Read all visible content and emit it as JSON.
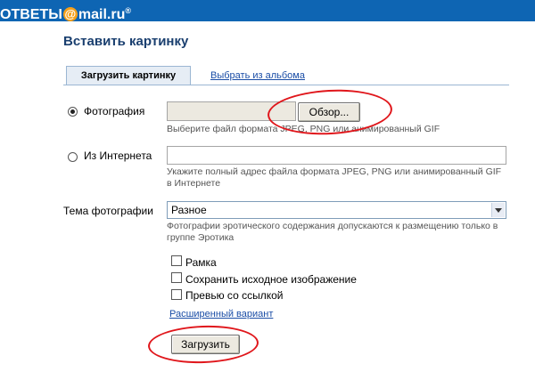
{
  "header": {
    "logo_prefix": "ОТВЕТЫ",
    "logo_at": "@",
    "logo_suffix": "mail.ru",
    "logo_reg": "®"
  },
  "page": {
    "title": "Вставить картинку"
  },
  "tabs": [
    {
      "label": "Загрузить картинку",
      "active": true
    },
    {
      "label": "Выбрать из альбома",
      "active": false
    }
  ],
  "photo": {
    "label": "Фотография",
    "selected": true,
    "browse_label": "Обзор...",
    "hint": "Выберите файл формата JPEG, PNG или анимированный GIF"
  },
  "internet": {
    "label": "Из Интернета",
    "selected": false,
    "hint": "Укажите полный адрес файла формата JPEG, PNG или анимированный GIF в Интернете"
  },
  "theme": {
    "label": "Тема фотографии",
    "selected_value": "Разное",
    "hint": "Фотографии эротического содержания допускаются к размещению только в группе Эротика"
  },
  "options": [
    {
      "label": "Рамка",
      "checked": false
    },
    {
      "label": "Сохранить исходное изображение",
      "checked": false
    },
    {
      "label": "Превью со ссылкой",
      "checked": false
    }
  ],
  "advanced_link": "Расширенный вариант",
  "upload_label": "Загрузить",
  "colors": {
    "header_bg": "#0e65b3",
    "title": "#1a3f6f",
    "link": "#1a4da6",
    "annotation": "#e0161b"
  }
}
